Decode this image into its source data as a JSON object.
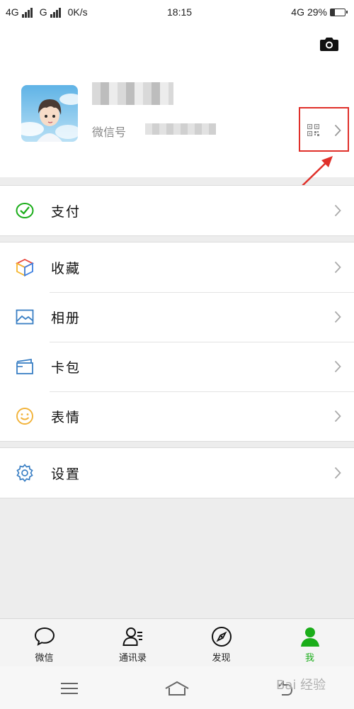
{
  "status_bar": {
    "network1": "4G",
    "network2": "G",
    "speed": "0K/s",
    "time": "18:15",
    "network_right": "4G",
    "battery_text": "29%",
    "battery_level": 0.29
  },
  "profile": {
    "nickname": "",
    "wechat_id_label": "微信号",
    "wechat_id_value": ""
  },
  "menu": {
    "pay": {
      "label": "支付",
      "icon": "wallet-check-icon"
    },
    "favorites": {
      "label": "收藏",
      "icon": "cube-icon"
    },
    "album": {
      "label": "相册",
      "icon": "image-icon"
    },
    "cards": {
      "label": "卡包",
      "icon": "card-icon"
    },
    "stickers": {
      "label": "表情",
      "icon": "smiley-icon"
    },
    "settings": {
      "label": "设置",
      "icon": "gear-icon"
    }
  },
  "tabbar": {
    "tabs": [
      {
        "label": "微信",
        "icon": "chat-bubble-icon",
        "active": false
      },
      {
        "label": "通讯录",
        "icon": "contacts-icon",
        "active": false
      },
      {
        "label": "发现",
        "icon": "compass-icon",
        "active": false
      },
      {
        "label": "我",
        "icon": "person-icon",
        "active": true
      }
    ]
  },
  "watermark": "Bai 经验",
  "colors": {
    "accent_green": "#1aad19",
    "highlight_red": "#e0302a",
    "background": "#ededed"
  }
}
